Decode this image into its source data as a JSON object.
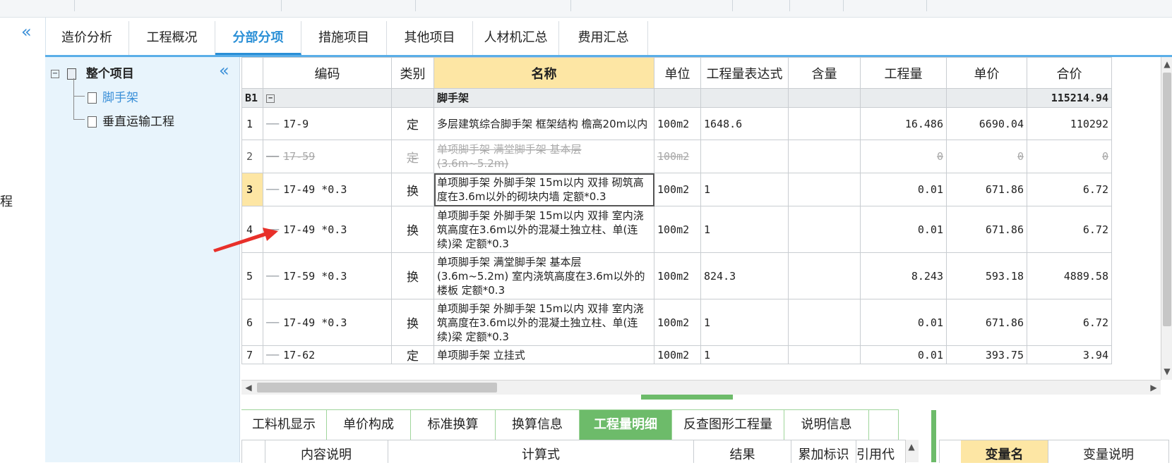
{
  "tabs": [
    "造价分析",
    "工程概况",
    "分部分项",
    "措施项目",
    "其他项目",
    "人材机汇总",
    "费用汇总"
  ],
  "active_tab": 2,
  "left_edge_text": "程",
  "tree": {
    "root": "整个项目",
    "children": [
      "脚手架",
      "垂直运输工程"
    ]
  },
  "grid": {
    "columns": [
      "",
      "编码",
      "类别",
      "名称",
      "单位",
      "工程量表达式",
      "含量",
      "工程量",
      "单价",
      "合价"
    ],
    "group": {
      "num": "B1",
      "name": "脚手架",
      "total": "115214.94"
    },
    "rows": [
      {
        "num": "1",
        "code": "17-9",
        "type": "定",
        "name": "多层建筑综合脚手架 框架结构 檐高20m以内",
        "unit": "100m2",
        "expr": "1648.6",
        "content": "",
        "qty": "16.486",
        "price": "6690.04",
        "total": "110292"
      },
      {
        "num": "2",
        "code": "17-59",
        "type": "定",
        "name": "单项脚手架 满堂脚手架 基本层(3.6m~5.2m)",
        "unit": "100m2",
        "expr": "",
        "content": "",
        "qty": "0",
        "price": "0",
        "total": "0"
      },
      {
        "num": "3",
        "code": "17-49 *0.3",
        "type": "换",
        "name": "单项脚手架 外脚手架 15m以内 双排 砌筑高度在3.6m以外的砌块内墙 定额*0.3",
        "unit": "100m2",
        "expr": "1",
        "content": "",
        "qty": "0.01",
        "price": "671.86",
        "total": "6.72"
      },
      {
        "num": "4",
        "code": "17-49 *0.3",
        "type": "换",
        "name": "单项脚手架 外脚手架 15m以内 双排 室内浇筑高度在3.6m以外的混凝土独立柱、单(连续)梁 定额*0.3",
        "unit": "100m2",
        "expr": "1",
        "content": "",
        "qty": "0.01",
        "price": "671.86",
        "total": "6.72"
      },
      {
        "num": "5",
        "code": "17-59 *0.3",
        "type": "换",
        "name": "单项脚手架 满堂脚手架 基本层(3.6m~5.2m) 室内浇筑高度在3.6m以外的楼板 定额*0.3",
        "unit": "100m2",
        "expr": "824.3",
        "content": "",
        "qty": "8.243",
        "price": "593.18",
        "total": "4889.58"
      },
      {
        "num": "6",
        "code": "17-49 *0.3",
        "type": "换",
        "name": "单项脚手架 外脚手架 15m以内 双排 室内浇筑高度在3.6m以外的混凝土独立柱、单(连续)梁 定额*0.3",
        "unit": "100m2",
        "expr": "1",
        "content": "",
        "qty": "0.01",
        "price": "671.86",
        "total": "6.72"
      },
      {
        "num": "7",
        "code": "17-62",
        "type": "定",
        "name": "单项脚手架 立挂式",
        "unit": "100m2",
        "expr": "1",
        "content": "",
        "qty": "0.01",
        "price": "393.75",
        "total": "3.94"
      }
    ]
  },
  "bottom_tabs": [
    "工料机显示",
    "单价构成",
    "标准换算",
    "换算信息",
    "工程量明细",
    "反查图形工程量",
    "说明信息"
  ],
  "bottom_active": 4,
  "bottom_columns": [
    "内容说明",
    "计算式",
    "结果",
    "累加标识",
    "引用代"
  ],
  "var_columns": [
    "变量名",
    "变量说明"
  ],
  "colors": {
    "accent_blue": "#2a8fd6",
    "accent_green": "#6dbb6a",
    "highlight": "#fde6a4",
    "arrow": "#e8302a"
  }
}
